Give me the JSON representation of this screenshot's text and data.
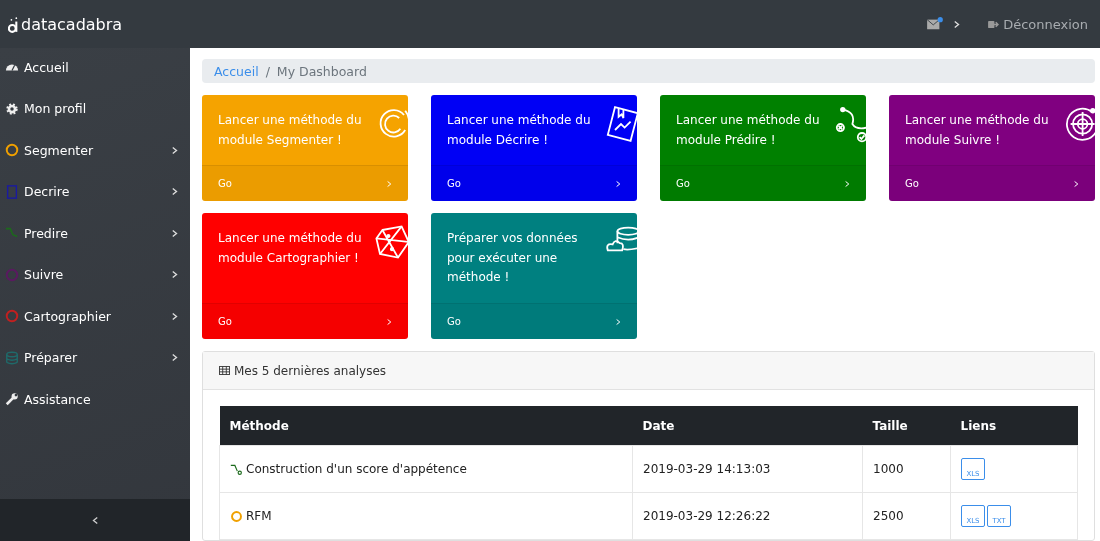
{
  "topbar": {
    "brand": "datacadabra",
    "logout": "Déconnexion",
    "notification": true
  },
  "sidebar": {
    "items": [
      {
        "label": "Accueil",
        "kind": "dashboard",
        "expandable": false
      },
      {
        "label": "Mon profil",
        "kind": "gear",
        "expandable": false
      },
      {
        "label": "Segmenter",
        "kind": "segment",
        "expandable": true,
        "color": "#f0a000"
      },
      {
        "label": "Decrire",
        "kind": "describe",
        "expandable": true,
        "color": "#1a1aa0"
      },
      {
        "label": "Predire",
        "kind": "predict",
        "expandable": true,
        "color": "#1c6a1c"
      },
      {
        "label": "Suivre",
        "kind": "follow",
        "expandable": true,
        "color": "#5a1a60"
      },
      {
        "label": "Cartographier",
        "kind": "map",
        "expandable": true,
        "color": "#c02020"
      },
      {
        "label": "Préparer",
        "kind": "prepare",
        "expandable": true,
        "color": "#1f6a6a"
      },
      {
        "label": "Assistance",
        "kind": "wrench",
        "expandable": false
      }
    ]
  },
  "breadcrumb": {
    "separator": "/",
    "items": [
      "Accueil",
      "My Dashboard"
    ]
  },
  "cards": [
    {
      "text": "Lancer une méthode du module Segmenter !",
      "action": "Go",
      "kind": "segment",
      "color": "#f5a300"
    },
    {
      "text": "Lancer une méthode du module Décrire !",
      "action": "Go",
      "kind": "describe",
      "color": "#0000f5"
    },
    {
      "text": "Lancer une méthode du module Prédire !",
      "action": "Go",
      "kind": "predict",
      "color": "#008000"
    },
    {
      "text": "Lancer une méthode du module Suivre !",
      "action": "Go",
      "kind": "follow",
      "color": "#800080"
    },
    {
      "text": "Lancer une méthode du module Cartographier !",
      "action": "Go",
      "kind": "map",
      "color": "#ff0000"
    },
    {
      "text": "Préparer vos données pour exécuter une méthode !",
      "action": "Go",
      "kind": "prepare",
      "color": "#008080"
    }
  ],
  "analyses": {
    "title": "Mes 5 dernières analyses",
    "table": {
      "columns": [
        "Méthode",
        "Date",
        "Taille",
        "Liens"
      ],
      "rows": [
        {
          "kind": "predict",
          "method": "Construction d'un score d'appétence",
          "date": "2019-03-29 14:13:03",
          "size": "1000",
          "links": [
            "XLS"
          ]
        },
        {
          "kind": "segment",
          "method": "RFM",
          "date": "2019-03-29 12:26:22",
          "size": "2500",
          "links": [
            "XLS",
            "TXT"
          ]
        }
      ]
    }
  }
}
